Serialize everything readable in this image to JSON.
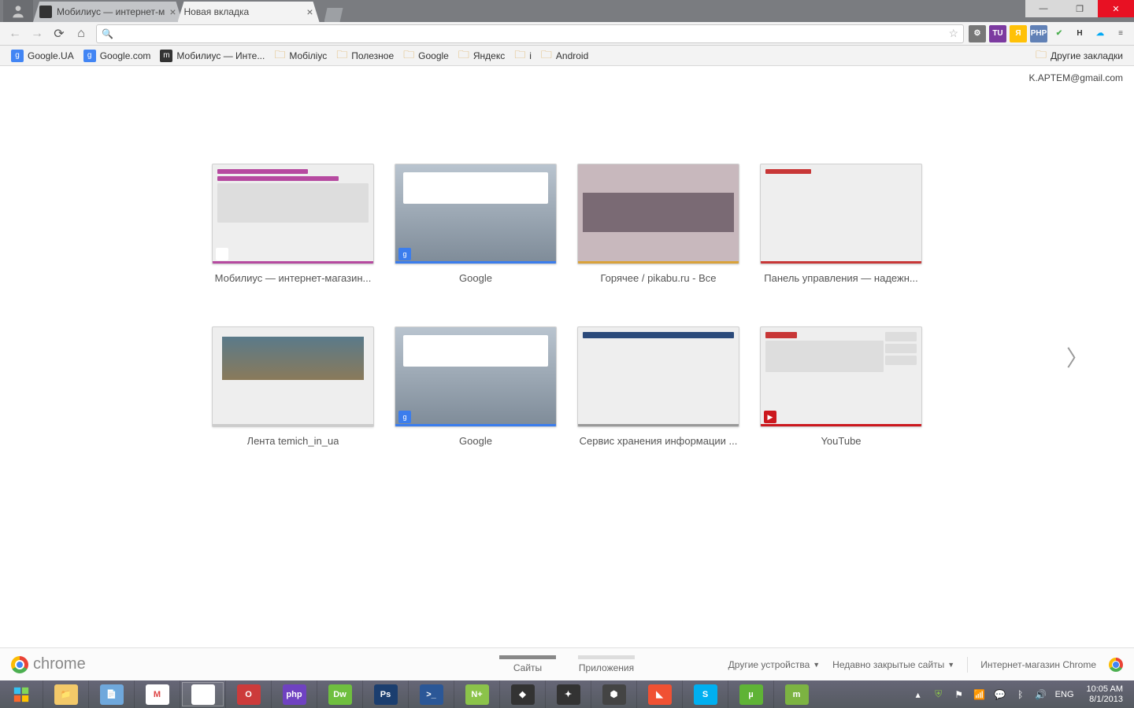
{
  "window": {
    "minimize": "—",
    "maximize": "❐",
    "close": "✕"
  },
  "tabs": [
    {
      "title": "Мобилиус — интернет-м",
      "active": false
    },
    {
      "title": "Новая вкладка",
      "active": true
    }
  ],
  "toolbar": {
    "url": ""
  },
  "extensions": [
    {
      "name": "settings",
      "bg": "#777",
      "glyph": "⚙"
    },
    {
      "name": "tu",
      "bg": "#7c3aa0",
      "glyph": "TU"
    },
    {
      "name": "ya",
      "bg": "#ffc107",
      "glyph": "Я"
    },
    {
      "name": "php",
      "bg": "#6181b6",
      "glyph": "PHP"
    },
    {
      "name": "check",
      "bg": "transparent",
      "glyph": "✔",
      "color": "#4caf50"
    },
    {
      "name": "h",
      "bg": "transparent",
      "glyph": "H",
      "color": "#333"
    },
    {
      "name": "cloud",
      "bg": "transparent",
      "glyph": "☁",
      "color": "#03a9f4"
    },
    {
      "name": "menu",
      "bg": "transparent",
      "glyph": "≡",
      "color": "#555"
    }
  ],
  "bookmarks": [
    {
      "label": "Google.UA",
      "icon": "g",
      "bg": "#4285f4"
    },
    {
      "label": "Google.com",
      "icon": "g",
      "bg": "#4285f4"
    },
    {
      "label": "Мобилиус — Инте...",
      "icon": "m",
      "bg": "#333"
    },
    {
      "label": "Мобіліус",
      "icon": "folder"
    },
    {
      "label": "Полезное",
      "icon": "folder"
    },
    {
      "label": "Google",
      "icon": "folder"
    },
    {
      "label": "Яндекс",
      "icon": "folder"
    },
    {
      "label": "i",
      "icon": "folder"
    },
    {
      "label": "Android",
      "icon": "folder"
    }
  ],
  "other_bookmarks": "Другие закладки",
  "user_email": "K.APTEM@gmail.com",
  "thumbnails": [
    {
      "label": "Мобилиус — интернет-магазин...",
      "accent": "#b64aa0",
      "badge_bg": "#fff"
    },
    {
      "label": "Google",
      "accent": "#3b7ded",
      "badge_bg": "#3b7ded",
      "badge_glyph": "g"
    },
    {
      "label": "Горячее / pikabu.ru - Все",
      "accent": "#d9a23a"
    },
    {
      "label": "Панель управления — надежн...",
      "accent": "#c83737"
    },
    {
      "label": "Лента temich_in_ua",
      "accent": "#ccc"
    },
    {
      "label": "Google",
      "accent": "#3b7ded",
      "badge_bg": "#3b7ded",
      "badge_glyph": "g"
    },
    {
      "label": "Сервис хранения информации ...",
      "accent": "#999"
    },
    {
      "label": "YouTube",
      "accent": "#cc181e",
      "badge_bg": "#cc181e",
      "badge_glyph": "▶"
    }
  ],
  "chrome_bar": {
    "logo": "chrome",
    "tabs": [
      {
        "label": "Сайты",
        "active": true
      },
      {
        "label": "Приложения",
        "active": false
      }
    ],
    "links": [
      "Другие устройства",
      "Недавно закрытые сайты",
      "Интернет-магазин Chrome"
    ]
  },
  "taskbar": {
    "apps": [
      {
        "name": "explorer",
        "bg": "#f3c969",
        "glyph": "📁"
      },
      {
        "name": "notepad",
        "bg": "#6fa8dc",
        "glyph": "📄"
      },
      {
        "name": "gmail",
        "bg": "#fff",
        "glyph": "M",
        "color": "#d44"
      },
      {
        "name": "chrome",
        "bg": "#fff",
        "glyph": "◉",
        "active": true
      },
      {
        "name": "opera",
        "bg": "#cc3b3b",
        "glyph": "O"
      },
      {
        "name": "phpstorm",
        "bg": "#6f42c1",
        "glyph": "php"
      },
      {
        "name": "dreamweaver",
        "bg": "#6fbf3f",
        "glyph": "Dw"
      },
      {
        "name": "photoshop",
        "bg": "#1b3e6f",
        "glyph": "Ps"
      },
      {
        "name": "powershell",
        "bg": "#2b5797",
        "glyph": ">_"
      },
      {
        "name": "npp",
        "bg": "#8bc34a",
        "glyph": "N+"
      },
      {
        "name": "app1",
        "bg": "#333",
        "glyph": "◆"
      },
      {
        "name": "app2",
        "bg": "#333",
        "glyph": "✦"
      },
      {
        "name": "app3",
        "bg": "#444",
        "glyph": "⬢"
      },
      {
        "name": "git",
        "bg": "#f05133",
        "glyph": "◣"
      },
      {
        "name": "skype",
        "bg": "#00aff0",
        "glyph": "S"
      },
      {
        "name": "utorrent",
        "bg": "#5fb336",
        "glyph": "µ"
      },
      {
        "name": "app4",
        "bg": "#7cb342",
        "glyph": "m"
      }
    ],
    "tray": {
      "lang": "ENG",
      "time": "10:05 AM",
      "date": "8/1/2013"
    }
  }
}
